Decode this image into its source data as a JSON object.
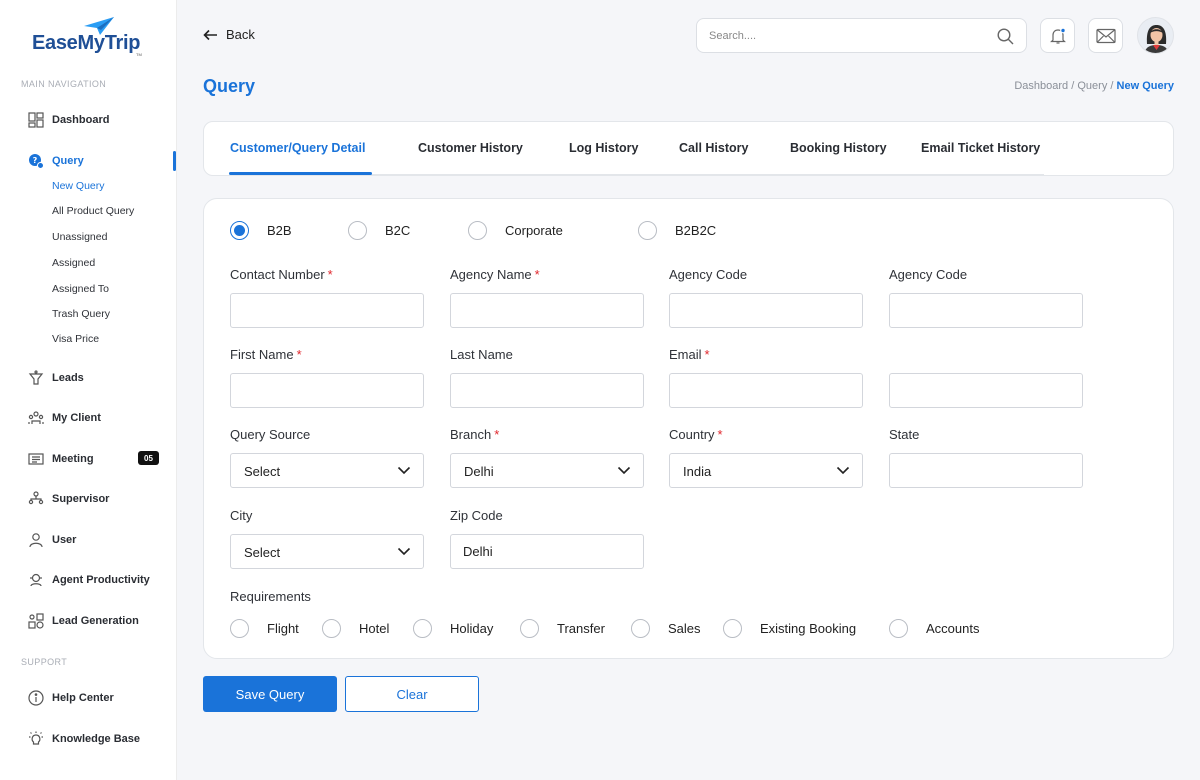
{
  "brand": {
    "name_part1": "EaseMy",
    "name_part2": "Trip",
    "tm": "TM",
    "color": "#1f4f96"
  },
  "sidebar": {
    "main_nav_title": "MAIN NAVIGATION",
    "support_title": "SUPPORT",
    "items": [
      {
        "label": "Dashboard",
        "icon": "grid-icon"
      },
      {
        "label": "Query",
        "icon": "query-icon"
      },
      {
        "label": "Leads",
        "icon": "leads-icon"
      },
      {
        "label": "My Client",
        "icon": "clients-icon"
      },
      {
        "label": "Meeting",
        "icon": "meeting-icon",
        "badge": "05"
      },
      {
        "label": "Supervisor",
        "icon": "supervisor-icon"
      },
      {
        "label": "User",
        "icon": "user-icon"
      },
      {
        "label": "Agent Productivity",
        "icon": "agent-icon"
      },
      {
        "label": "Lead Generation",
        "icon": "lead-gen-icon"
      }
    ],
    "query_sub": [
      "New Query",
      "All Product Query",
      "Unassigned",
      "Assigned",
      "Assigned To",
      "Trash Query",
      "Visa Price"
    ],
    "support_items": [
      {
        "label": "Help Center",
        "icon": "info-icon"
      },
      {
        "label": "Knowledge Base",
        "icon": "bulb-icon"
      }
    ]
  },
  "header": {
    "back_label": "Back",
    "search_placeholder": "Search...."
  },
  "page": {
    "title": "Query",
    "breadcrumb": {
      "part1": "Dashboard",
      "sep": "/",
      "part2": "Query",
      "current": "New Query"
    }
  },
  "tabs": [
    "Customer/Query Detail",
    "Customer History",
    "Log History",
    "Call History",
    "Booking History",
    "Email Ticket History"
  ],
  "form": {
    "types": [
      "B2B",
      "B2C",
      "Corporate",
      "B2B2C"
    ],
    "selected_type": "B2B",
    "labels": {
      "contact_number": "Contact Number",
      "agency_name": "Agency Name",
      "agency_code_1": "Agency Code",
      "agency_code_2": "Agency Code",
      "first_name": "First Name",
      "last_name": "Last Name",
      "email": "Email",
      "query_source": "Query Source",
      "branch": "Branch",
      "country": "Country",
      "state": "State",
      "city": "City",
      "zip_code": "Zip Code",
      "requirements": "Requirements"
    },
    "required_mark": "*",
    "values": {
      "query_source": "Select",
      "branch": "Delhi",
      "country": "India",
      "city": "Select",
      "zip_code": "Delhi"
    },
    "requirements": [
      "Flight",
      "Hotel",
      "Holiday",
      "Transfer",
      "Sales",
      "Existing Booking",
      "Accounts"
    ]
  },
  "buttons": {
    "save": "Save Query",
    "clear": "Clear"
  },
  "colors": {
    "accent": "#1a73d9",
    "required": "#e0252b"
  }
}
